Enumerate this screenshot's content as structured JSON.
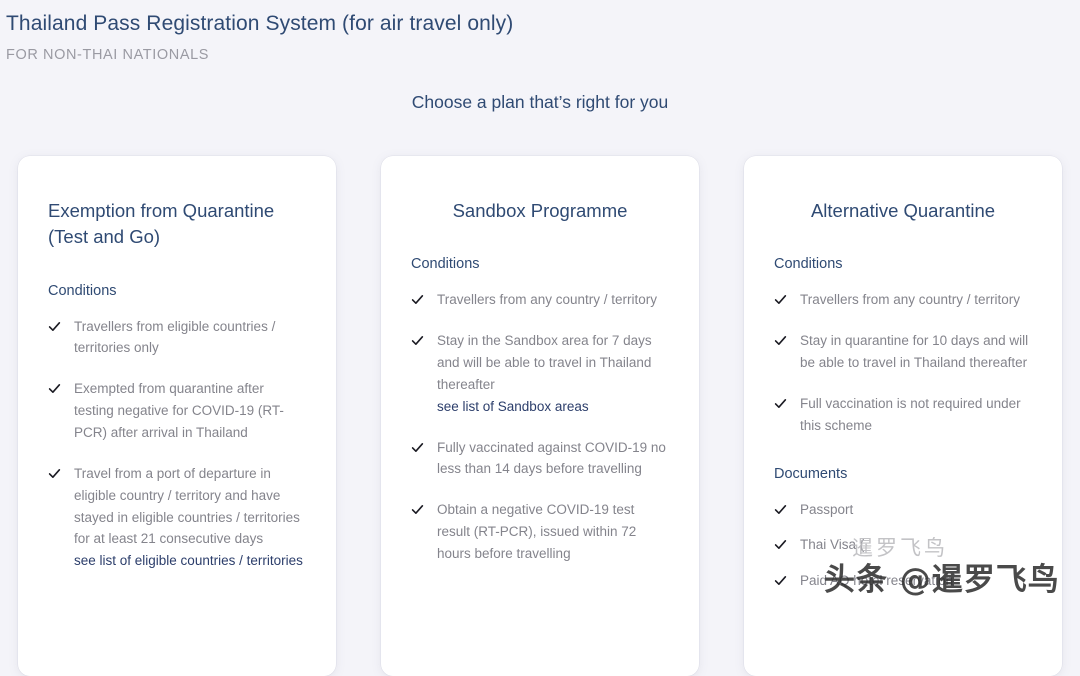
{
  "header": {
    "title": "Thailand Pass Registration System (for air travel only)",
    "subtitle": "FOR NON-THAI NATIONALS"
  },
  "section": {
    "choose_plan": "Choose a plan that’s right for you"
  },
  "labels": {
    "conditions": "Conditions",
    "documents": "Documents"
  },
  "cards": [
    {
      "title": "Exemption from Quarantine (Test and Go)",
      "conditions": [
        "Travellers from eligible countries / territories only",
        "Exempted from quarantine after testing negative for COVID-19 (RT-PCR) after arrival in Thailand",
        "Travel from a port of departure in eligible country / territory and have stayed in eligible countries / territories for at least 21 consecutive days"
      ],
      "link": "see list of eligible countries / territories"
    },
    {
      "title": "Sandbox Programme",
      "conditions": [
        "Travellers from any country / territory",
        "Stay in the Sandbox area for 7 days and will be able to travel in Thailand thereafter",
        "Fully vaccinated against COVID-19 no less than 14 days before travelling",
        "Obtain a negative COVID-19 test result (RT-PCR), issued within 72 hours before travelling"
      ],
      "link": "see list of Sandbox areas"
    },
    {
      "title": "Alternative Quarantine",
      "conditions": [
        "Travellers from any country / territory",
        "Stay in quarantine for 10 days and will be able to travel in Thailand thereafter",
        "Full vaccination is not required under this scheme"
      ],
      "documents": [
        "Passport",
        "Thai Visa (",
        "Paid AQ hotel reservation"
      ]
    }
  ],
  "watermark": {
    "ghost": "暹罗飞鸟",
    "main": "头条 @暹罗飞鸟"
  },
  "colors": {
    "page_background": "#f4f4f9",
    "card_background": "#ffffff",
    "heading_navy": "#2f4a73",
    "body_grey": "#84848c",
    "link_navy": "#2c3e6b",
    "subtitle_grey": "#9a9aa3"
  }
}
